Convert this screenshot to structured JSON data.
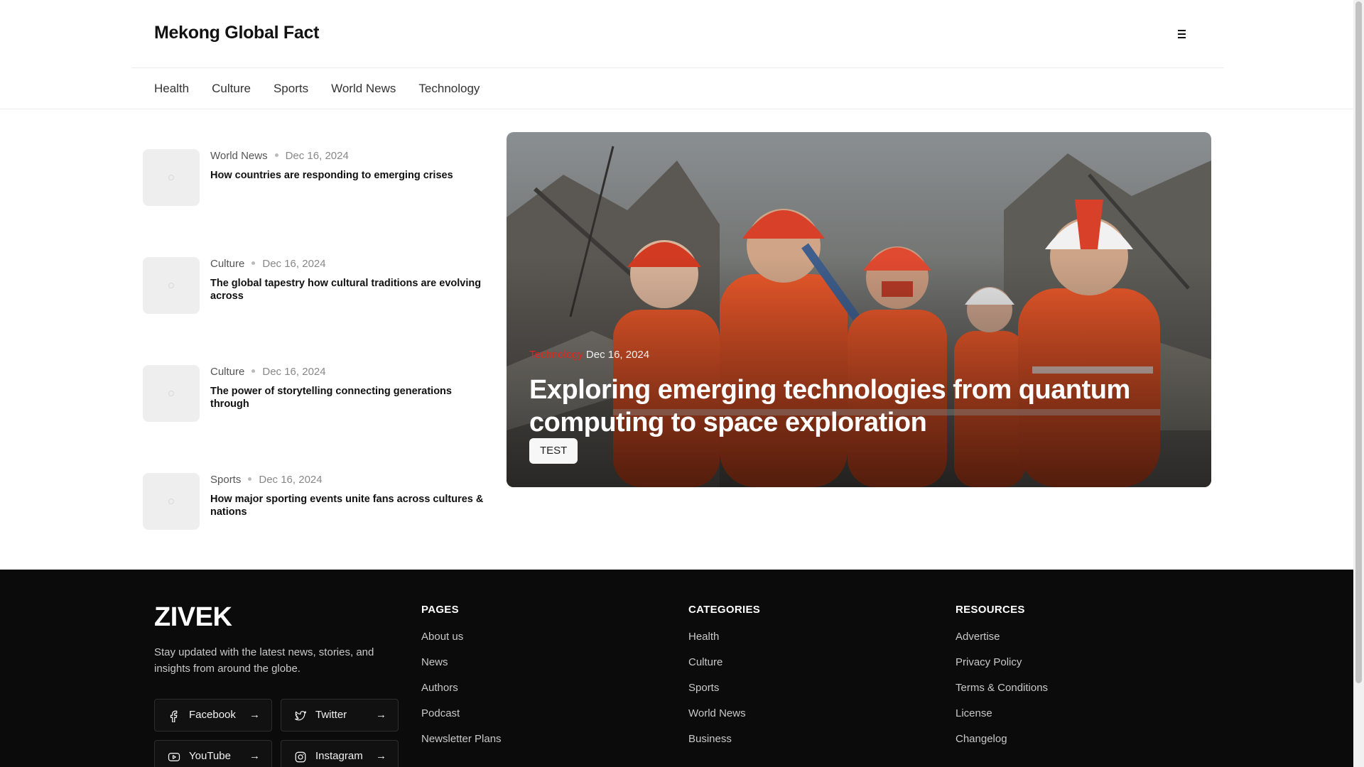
{
  "header": {
    "brand": "Mekong Global Fact",
    "menu_icon": "hamburger-icon"
  },
  "nav": {
    "categories": [
      "Health",
      "Culture",
      "Sports",
      "World News",
      "Technology"
    ]
  },
  "articles": [
    {
      "category": "World News",
      "date": "Dec 16, 2024",
      "title": "How countries are responding to emerging crises"
    },
    {
      "category": "Culture",
      "date": "Dec 16, 2024",
      "title": "The global tapestry how cultural traditions are evolving across"
    },
    {
      "category": "Culture",
      "date": "Dec 16, 2024",
      "title": "The power of storytelling connecting generations through"
    },
    {
      "category": "Sports",
      "date": "Dec 16, 2024",
      "title": "How major sporting events unite fans across cultures & nations"
    }
  ],
  "hero": {
    "category": "Technology",
    "date": "Dec 16, 2024",
    "title": "Exploring emerging technologies from quantum computing to space exploration",
    "tag": "TEST",
    "category_color": "#e1251b"
  },
  "footer": {
    "logo": "ZIVEK",
    "about": "Stay updated with the latest news, stories, and insights from around the globe.",
    "social": [
      {
        "label": "Facebook",
        "icon": "facebook-icon"
      },
      {
        "label": "Twitter",
        "icon": "twitter-icon"
      },
      {
        "label": "YouTube",
        "icon": "youtube-icon"
      },
      {
        "label": "Instagram",
        "icon": "instagram-icon"
      }
    ],
    "columns": [
      {
        "heading": "PAGES",
        "links": [
          "About us",
          "News",
          "Authors",
          "Podcast",
          "Newsletter Plans"
        ]
      },
      {
        "heading": "CATEGORIES",
        "links": [
          "Health",
          "Culture",
          "Sports",
          "World News",
          "Business"
        ]
      },
      {
        "heading": "RESOURCES",
        "links": [
          "Advertise",
          "Privacy Policy",
          "Terms & Conditions",
          "License",
          "Changelog"
        ]
      }
    ]
  },
  "colors": {
    "footer_bg": "#0b0b0b",
    "accent": "#e1251b"
  }
}
